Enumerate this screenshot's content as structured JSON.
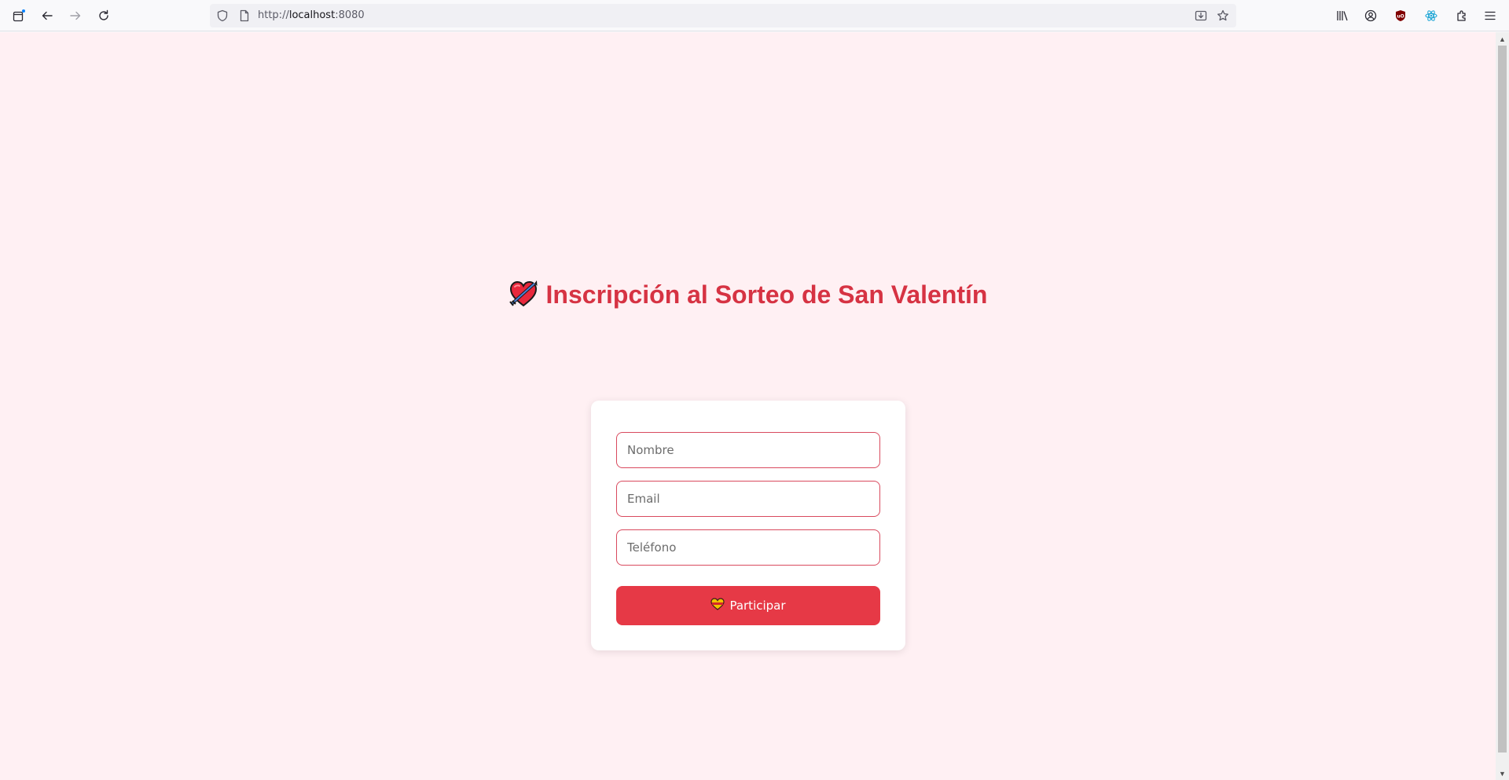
{
  "browser": {
    "url_prefix": "http://",
    "url_host": "localhost",
    "url_suffix": ":8080"
  },
  "page": {
    "title": "Inscripción al Sorteo de San Valentín",
    "title_icon": "heart-with-arrow-icon",
    "form": {
      "name_placeholder": "Nombre",
      "email_placeholder": "Email",
      "phone_placeholder": "Teléfono",
      "submit_label": "Participar",
      "submit_icon": "heart-icon"
    }
  },
  "colors": {
    "background": "#fff0f3",
    "accent": "#e63946",
    "title": "#d63343",
    "input_border": "#d94a5e"
  }
}
